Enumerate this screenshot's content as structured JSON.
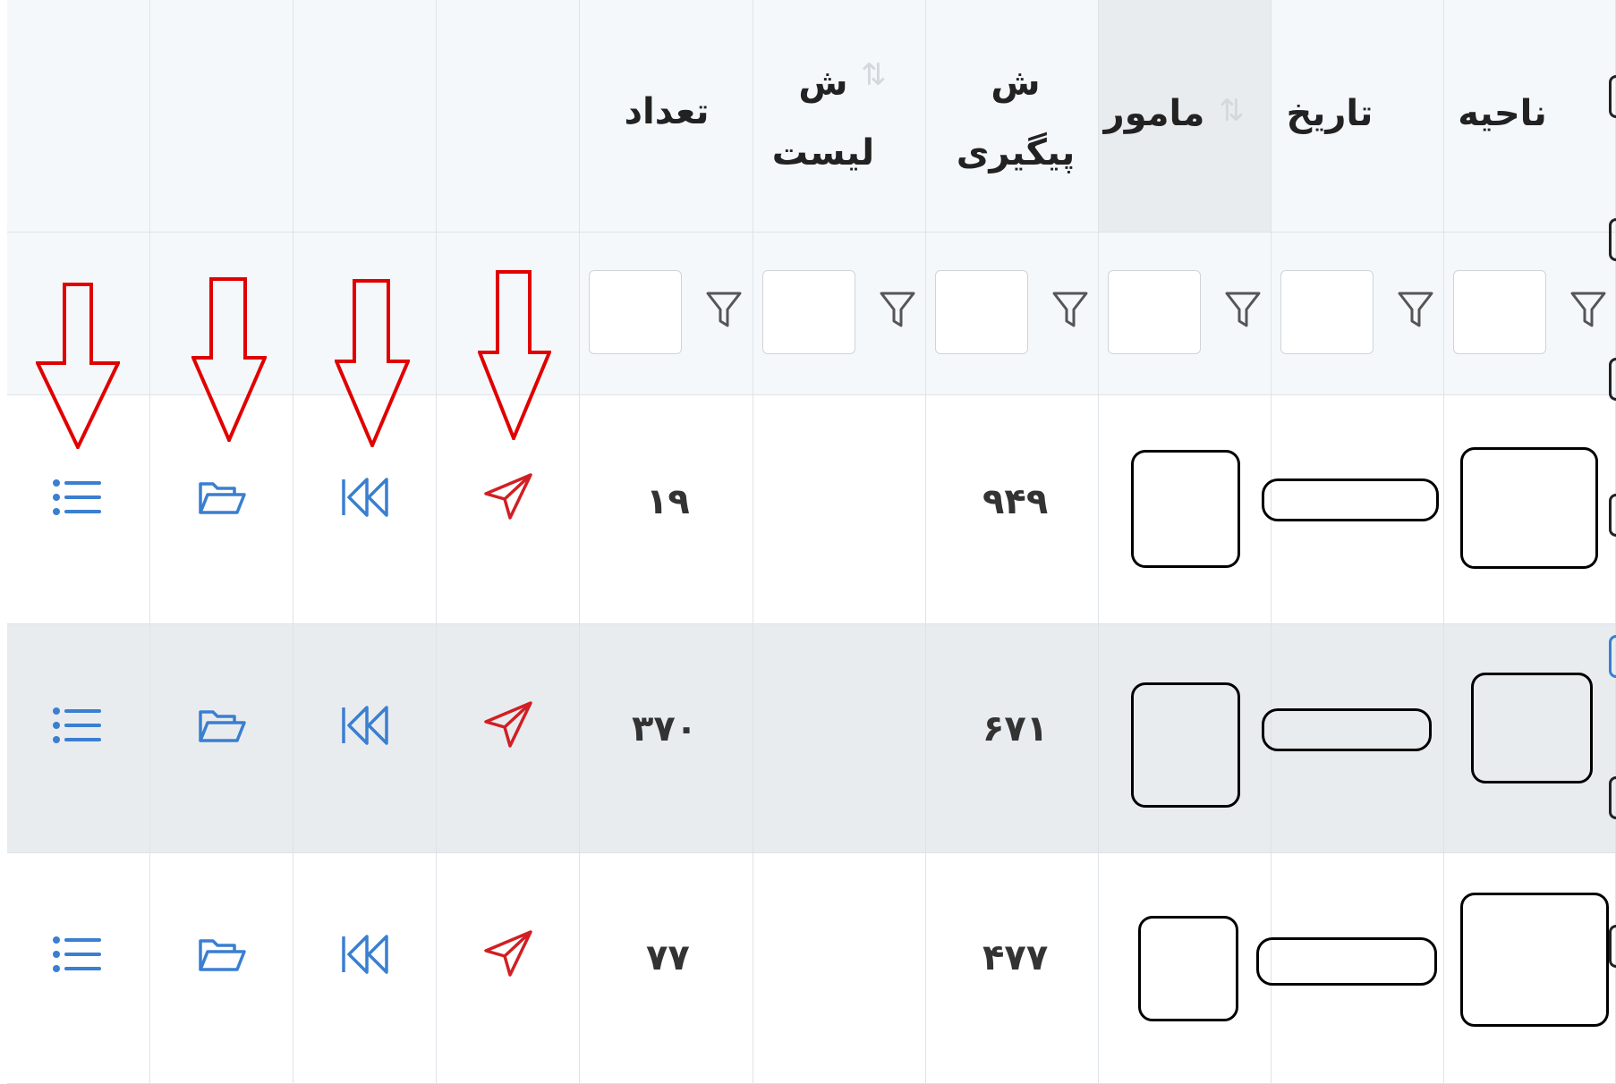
{
  "table": {
    "headers": [
      {
        "key": "actions_list",
        "label": ""
      },
      {
        "key": "actions_folder",
        "label": ""
      },
      {
        "key": "actions_back",
        "label": ""
      },
      {
        "key": "actions_send",
        "label": ""
      },
      {
        "key": "count",
        "label": "تعداد"
      },
      {
        "key": "list_no",
        "label": "ش\nلیست"
      },
      {
        "key": "tracking_no",
        "label": "ش\nپیگیری"
      },
      {
        "key": "officer",
        "label": "مامور"
      },
      {
        "key": "date",
        "label": "تاریخ"
      },
      {
        "key": "region",
        "label": "ناحیه"
      }
    ],
    "rows": [
      {
        "count": "۱۹",
        "list_no": "",
        "tracking_no": "۹۴۹"
      },
      {
        "count": "۳۷۰",
        "list_no": "",
        "tracking_no": "۶۷۱"
      },
      {
        "count": "۷۷",
        "list_no": "",
        "tracking_no": "۴۷۷"
      }
    ]
  },
  "icons": {
    "list": "list-icon",
    "folder": "folder-open-icon",
    "back": "skip-back-icon",
    "send": "send-icon",
    "filter": "filter-icon",
    "sort": "sort-icon"
  },
  "colors": {
    "accent_blue": "#3a7fd0",
    "send_red": "#d11f23",
    "annotation_red": "#e00000"
  }
}
